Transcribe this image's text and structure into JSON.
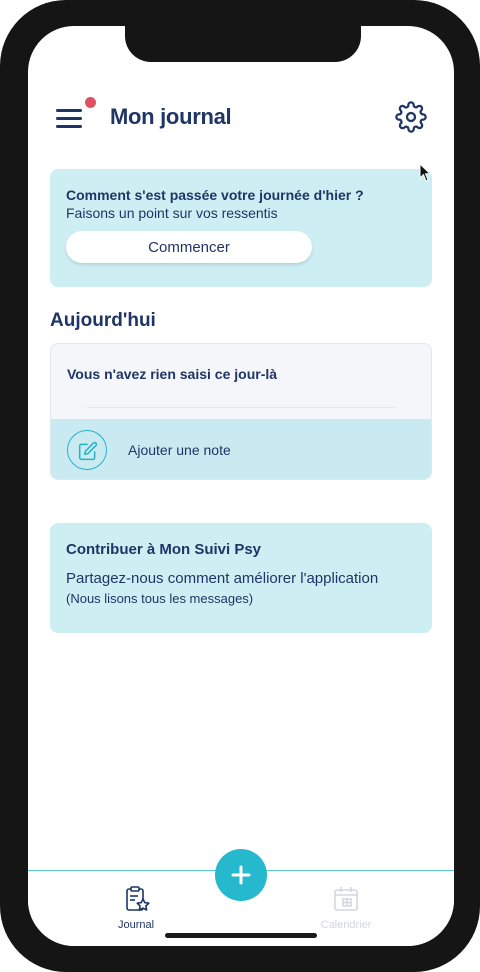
{
  "header": {
    "title": "Mon journal",
    "menu_icon": "hamburger-menu-icon",
    "settings_icon": "gear-icon",
    "notification_color": "#e05261"
  },
  "prompt_card": {
    "title": "Comment s'est passée votre journée d'hier ?",
    "subtitle": "Faisons un point sur vos ressentis",
    "button_label": "Commencer"
  },
  "today": {
    "heading": "Aujourd'hui",
    "empty_text": "Vous n'avez rien saisi ce jour-là",
    "add_note_label": "Ajouter une note",
    "add_note_icon": "edit-note-icon"
  },
  "contribute_card": {
    "title": "Contribuer à Mon Suivi Psy",
    "text_main": "Partagez-nous comment améliorer l'application",
    "text_small": "(Nous lisons tous les messages)"
  },
  "tabbar": {
    "tabs": [
      {
        "label": "Journal",
        "icon": "clipboard-star-icon",
        "active": true
      },
      {
        "label": "Calendrier",
        "icon": "calendar-icon",
        "active": false
      }
    ],
    "fab_icon": "plus-icon"
  },
  "colors": {
    "primary_text": "#1f3566",
    "accent": "#26b8cc",
    "card_background": "#cdeff3"
  }
}
